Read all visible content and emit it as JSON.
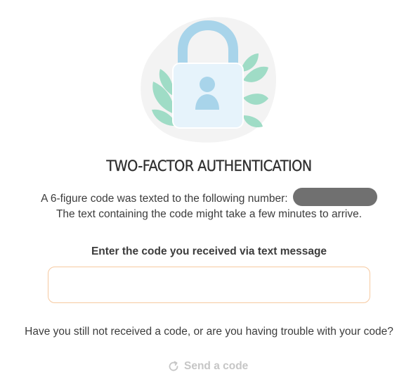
{
  "header": {
    "title": "TWO-FACTOR AUTHENTICATION",
    "illustration_icon": "padlock-user-icon"
  },
  "info": {
    "line1": "A 6-figure code was texted to the following number:",
    "line2": "The text containing the code might take a few minutes to arrive."
  },
  "code_field": {
    "label": "Enter the code you received via text message",
    "value": "",
    "placeholder": ""
  },
  "help": {
    "trouble_text": "Have you still not received a code, or are you having trouble with your code?",
    "send_code_label": "Send a code",
    "send_code_icon": "refresh-icon"
  },
  "colors": {
    "lock_blue": "#a8d4ea",
    "lock_body": "#e6f3fb",
    "leaf_green": "#9fdcc6",
    "input_border": "#f6c9a0",
    "disabled_text": "#c6c6c6"
  }
}
